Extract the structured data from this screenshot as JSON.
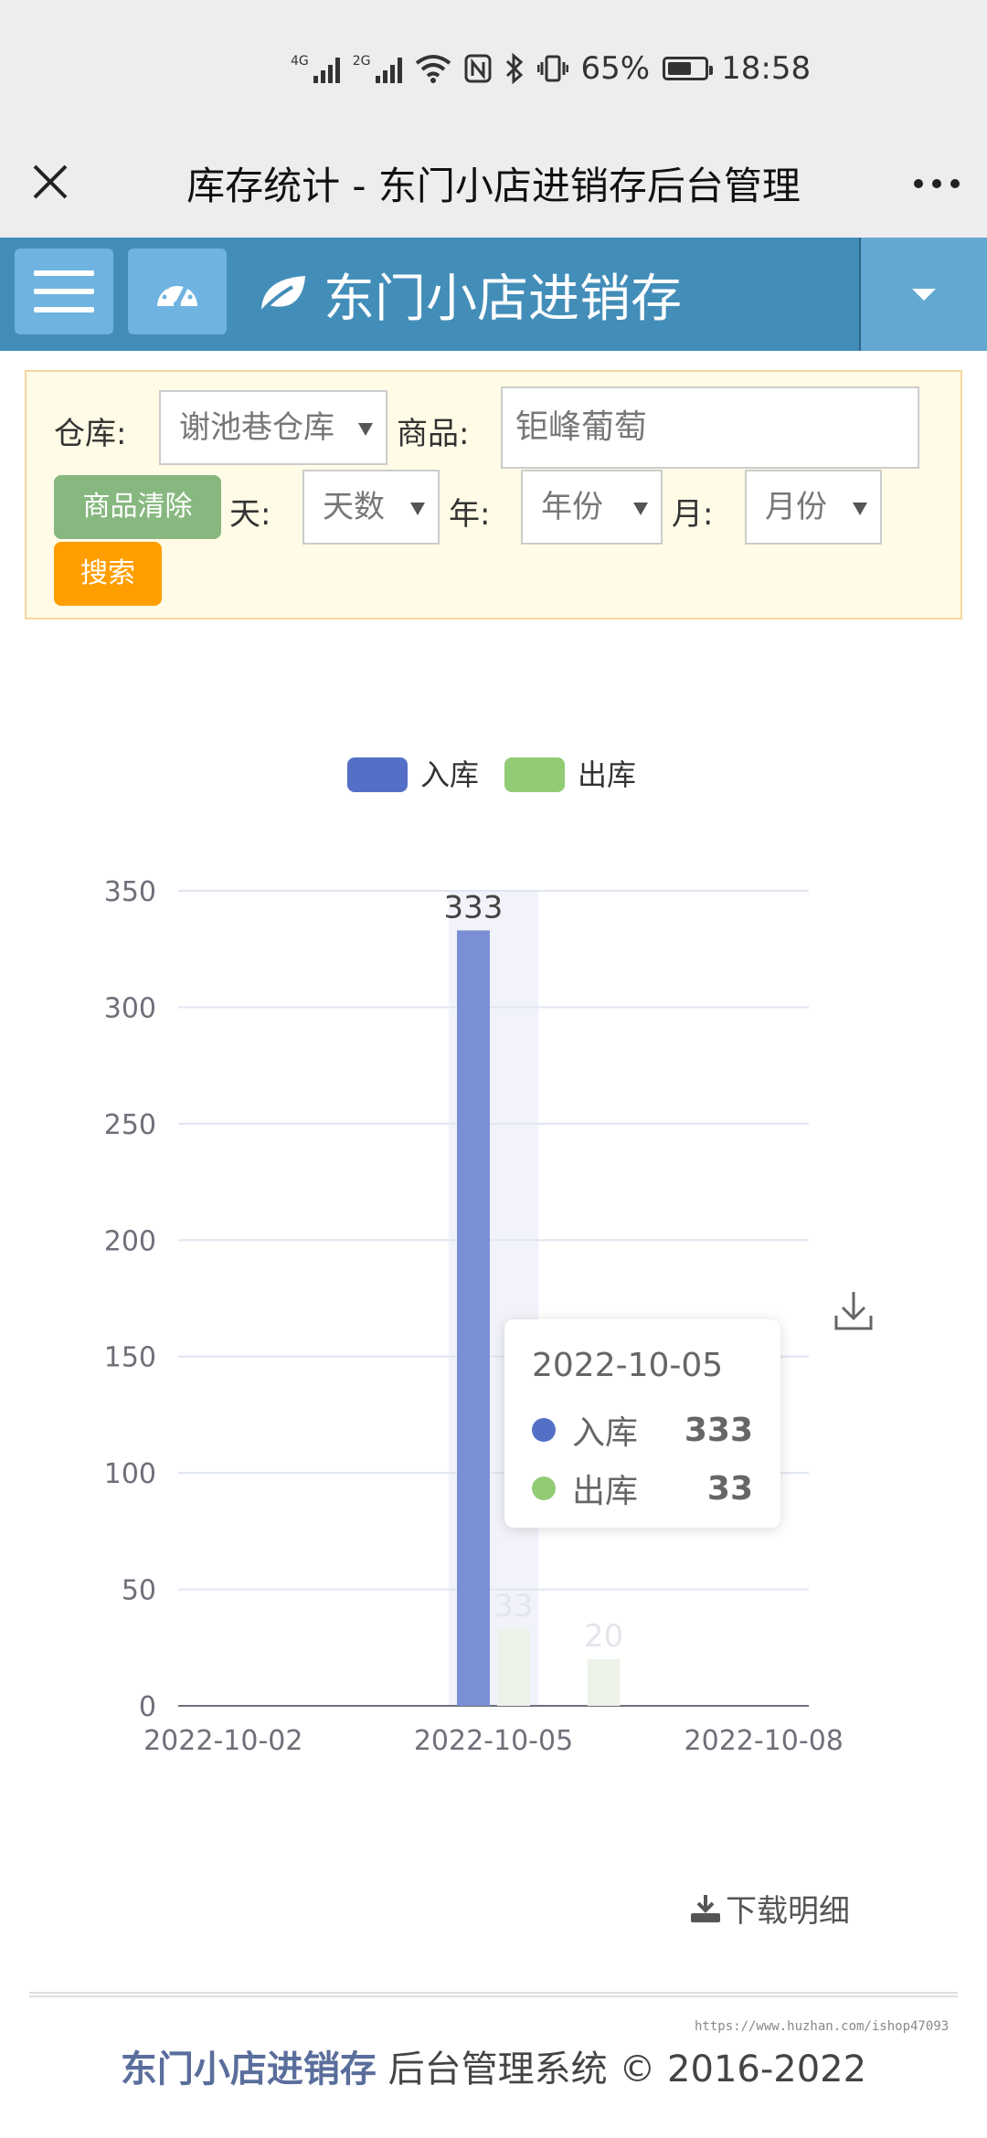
{
  "status_bar": {
    "network1": "4G",
    "network2": "2G",
    "battery_percent": "65%",
    "battery_level": 0.65,
    "time": "18:58"
  },
  "titlebar": {
    "close_icon": "close-icon",
    "title": "库存统计 - 东门小店进销存后台管理",
    "more_icon": "more-icon"
  },
  "header": {
    "menu_icon": "hamburger-icon",
    "dashboard_icon": "dashboard-icon",
    "brand_icon": "leaf-icon",
    "brand": "东门小店进销存",
    "dropdown_icon": "caret-down-icon"
  },
  "filters": {
    "warehouse_label": "仓库:",
    "warehouse_value": "谢池巷仓库",
    "product_label": "商品:",
    "product_value": "钜峰葡萄",
    "clear_product_button": "商品清除",
    "day_label": "天:",
    "day_value": "天数",
    "year_label": "年:",
    "year_value": "年份",
    "month_label": "月:",
    "month_value": "月份",
    "search_button": "搜索"
  },
  "colors": {
    "header_blue": "#438eb9",
    "in_series": "#5470c6",
    "out_series": "#91cc75",
    "search_orange": "#ff9e00",
    "clear_green": "#87b87f"
  },
  "chart_data": {
    "type": "bar",
    "legend": [
      "入库",
      "出库"
    ],
    "legend_position": "top-center",
    "categories": [
      "2022-10-02",
      "2022-10-03",
      "2022-10-04",
      "2022-10-05",
      "2022-10-06",
      "2022-10-07",
      "2022-10-08"
    ],
    "x_tick_labels": [
      "2022-10-02",
      "2022-10-05",
      "2022-10-08"
    ],
    "series": [
      {
        "name": "入库",
        "values": [
          0,
          0,
          0,
          333,
          0,
          0,
          0
        ]
      },
      {
        "name": "出库",
        "values": [
          0,
          0,
          0,
          33,
          20,
          0,
          0
        ]
      }
    ],
    "data_labels": [
      {
        "category": "2022-10-05",
        "series": "入库",
        "text": "333"
      },
      {
        "category": "2022-10-05",
        "series": "出库",
        "text": "33"
      },
      {
        "category": "2022-10-06",
        "series": "出库",
        "text": "20"
      }
    ],
    "y_ticks": [
      0,
      50,
      100,
      150,
      200,
      250,
      300,
      350
    ],
    "ylim": [
      0,
      350
    ],
    "grid": true,
    "highlighted_category": "2022-10-05",
    "tooltip": {
      "date": "2022-10-05",
      "rows": [
        {
          "name": "入库",
          "value": "333"
        },
        {
          "name": "出库",
          "value": "33"
        }
      ]
    }
  },
  "chart_tools": {
    "save_icon": "download-icon"
  },
  "download_detail": "下载明细",
  "watermark": "https://www.huzhan.com/ishop47093",
  "footer": {
    "brand": "东门小店进销存",
    "text": "后台管理系统 © 2016-2022"
  }
}
